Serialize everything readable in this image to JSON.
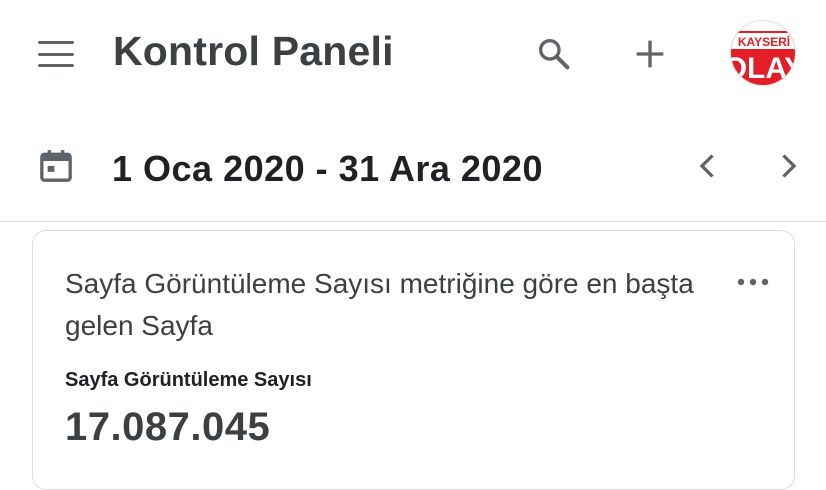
{
  "app_bar": {
    "menu_icon": "menu-icon",
    "title": "Kontrol Paneli",
    "search_icon": "search-icon",
    "add_icon": "add-icon",
    "avatar": {
      "logo_text_top": "KAYSERİ",
      "logo_text_bottom": "OLAY",
      "colors": {
        "primary": "#e41e26",
        "secondary": "#ffffff"
      }
    }
  },
  "date_bar": {
    "calendar_icon": "calendar-icon",
    "range": "1 Oca 2020 - 31 Ara 2020",
    "prev_icon": "chevron-left-icon",
    "next_icon": "chevron-right-icon"
  },
  "card": {
    "title": "Sayfa Görüntüleme Sayısı metriğine göre en başta gelen Sayfa",
    "more_icon": "more-horizontal-icon",
    "metric_label": "Sayfa Görüntüleme Sayısı",
    "metric_value": "17.087.045"
  },
  "colors": {
    "icon_gray": "#5f6368",
    "text_dark": "#202124",
    "border": "#dadce0"
  }
}
